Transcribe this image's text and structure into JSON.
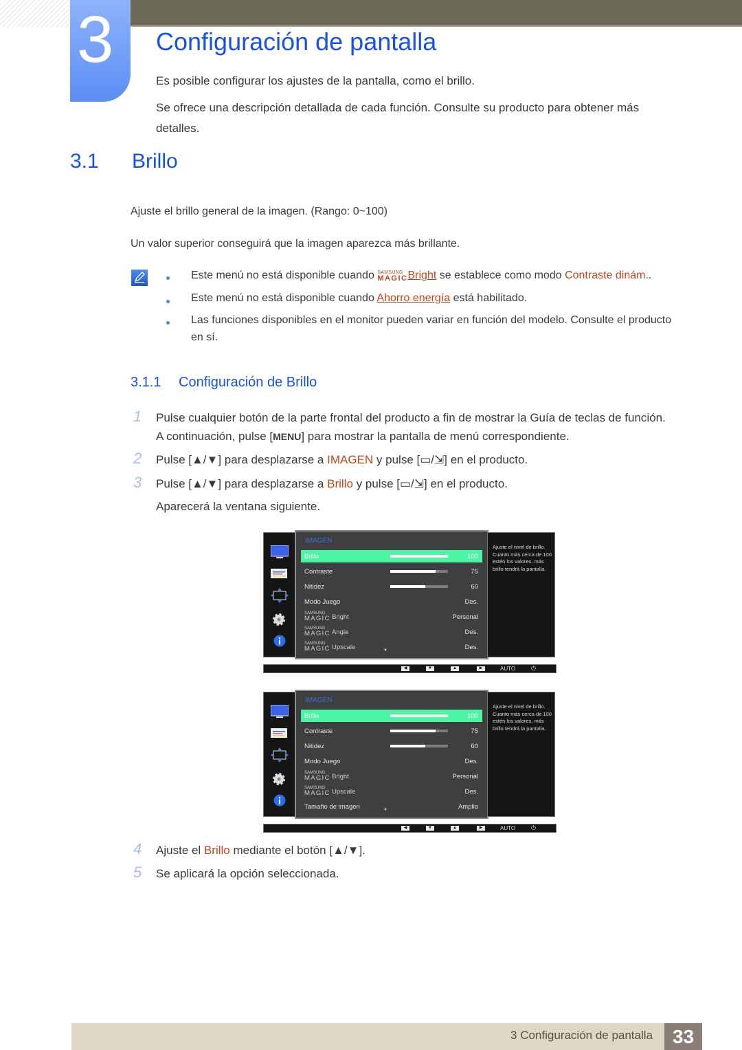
{
  "chapter": {
    "number": "3",
    "title": "Configuración de pantalla",
    "intro1": "Es posible configurar los ajustes de la pantalla, como el brillo.",
    "intro2a": "Se ofrece una descripción detallada de cada función. Consulte su producto para obtener más",
    "intro2b": "detalles."
  },
  "section": {
    "number": "3.1",
    "title": "Brillo",
    "desc1": "Ajuste el brillo general de la imagen. (Rango: 0~100)",
    "desc2": "Un valor superior conseguirá que la imagen aparezca más brillante."
  },
  "notes": [
    {
      "pre": "Este menú no está disponible cuando",
      "magic_top": "SAMSUNG",
      "magic_bot": "MAGIC",
      "link": "Bright",
      "mid": "se establece como modo",
      "highlight": "Contraste dinám.",
      "post": "."
    },
    {
      "pre": "Este menú no está disponible cuando",
      "link": "Ahorro energía",
      "post": "está habilitado."
    },
    {
      "line1": "Las funciones disponibles en el monitor pueden variar en función del modelo. Consulte el producto",
      "line2": "en sí."
    }
  ],
  "subsection": {
    "number": "3.1.1",
    "title": "Configuración de Brillo"
  },
  "steps": [
    {
      "num": "1",
      "line1": "Pulse cualquier botón de la parte frontal del producto a fin de mostrar la Guía de teclas de función.",
      "line2a": "A continuación, pulse [",
      "key": "MENU",
      "line2b": "] para mostrar la pantalla de menú correspondiente."
    },
    {
      "num": "2",
      "pre": "Pulse [▲/▼] para desplazarse a",
      "target": "IMAGEN",
      "mid": "y pulse [",
      "keys": "▭/⇲",
      "post": "] en el producto."
    },
    {
      "num": "3",
      "pre": "Pulse [▲/▼] para desplazarse a",
      "target": "Brillo",
      "mid": "y pulse [",
      "keys": "▭/⇲",
      "post": "] en el producto.",
      "line2": "Aparecerá la ventana siguiente."
    },
    {
      "num": "4",
      "pre": "Ajuste el",
      "target": "Brillo",
      "post": "mediante el botón [▲/▼]."
    },
    {
      "num": "5",
      "text": "Se aplicará la opción seleccionada."
    }
  ],
  "osd1": {
    "category": "IMAGEN",
    "help": "Ajuste el nivel de brillo. Cuanto más cerca de 100 estén los valores, más brillo tendrá la pantalla.",
    "rows": [
      {
        "label": "Brillo",
        "value": "100",
        "level": 100
      },
      {
        "label": "Contraste",
        "value": "75",
        "level": 75
      },
      {
        "label": "Nitidez",
        "value": "60",
        "level": 60
      },
      {
        "label": "Modo Juego",
        "value": "Des."
      },
      {
        "magic": "Bright",
        "value": "Personal"
      },
      {
        "magic": "Angle",
        "value": "Des."
      },
      {
        "magic": "Upscale",
        "value": "Des."
      }
    ]
  },
  "osd2": {
    "category": "IMAGEN",
    "help": "Ajuste el nivel de brillo. Cuanto más cerca de 100 estén los valores, más brillo tendrá la pantalla.",
    "rows": [
      {
        "label": "Brillo",
        "value": "100",
        "level": 100
      },
      {
        "label": "Contraste",
        "value": "75",
        "level": 75
      },
      {
        "label": "Nitidez",
        "value": "60",
        "level": 60
      },
      {
        "label": "Modo Juego",
        "value": "Des."
      },
      {
        "magic": "Bright",
        "value": "Personal"
      },
      {
        "magic": "Upscale",
        "value": "Des."
      },
      {
        "label": "Tamaño de imagen",
        "value": "Amplio"
      }
    ]
  },
  "osd_common": {
    "magic_top": "SAMSUNG",
    "magic_bot": "MAGIC",
    "keys": [
      "◀",
      "▼",
      "▲",
      "▶"
    ],
    "auto": "AUTO",
    "power": "⏻",
    "scroll": "▼"
  },
  "footer": {
    "text": "3 Configuración de pantalla",
    "page": "33"
  },
  "colors": {
    "heading_blue": "#1650f0",
    "highlight_red": "#c6441a",
    "osd_selected": "#4cf5a3"
  }
}
